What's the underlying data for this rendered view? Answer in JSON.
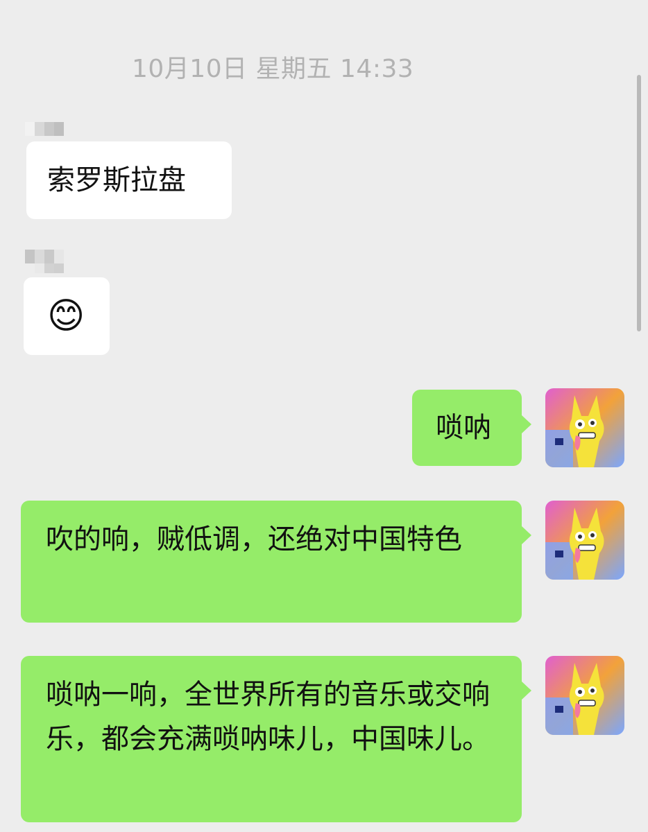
{
  "chat": {
    "timestamp": "10月10日 星期五 14:33",
    "messages": [
      {
        "direction": "incoming",
        "text": "索罗斯拉盘"
      },
      {
        "direction": "incoming",
        "emoji": "😊"
      },
      {
        "direction": "outgoing",
        "text": "唢呐"
      },
      {
        "direction": "outgoing",
        "text": "吹的响，贼低调，还绝对中国特色"
      },
      {
        "direction": "outgoing",
        "text": "唢呐一响，全世界所有的音乐或交响乐，都会充满唢呐味儿，中国味儿。"
      }
    ]
  },
  "avatar": {
    "icon": "cartoon-creature-avatar",
    "colors": {
      "bg_top": "#e05fd0",
      "bg_mid": "#f2a23a",
      "bg_bottom": "#7aa6ff",
      "figure": "#f5e23a",
      "tongue": "#f27aa0"
    }
  },
  "colors": {
    "background": "#ededed",
    "incoming_bubble": "#ffffff",
    "outgoing_bubble": "#95ec69",
    "timestamp": "#b2b2b2"
  }
}
